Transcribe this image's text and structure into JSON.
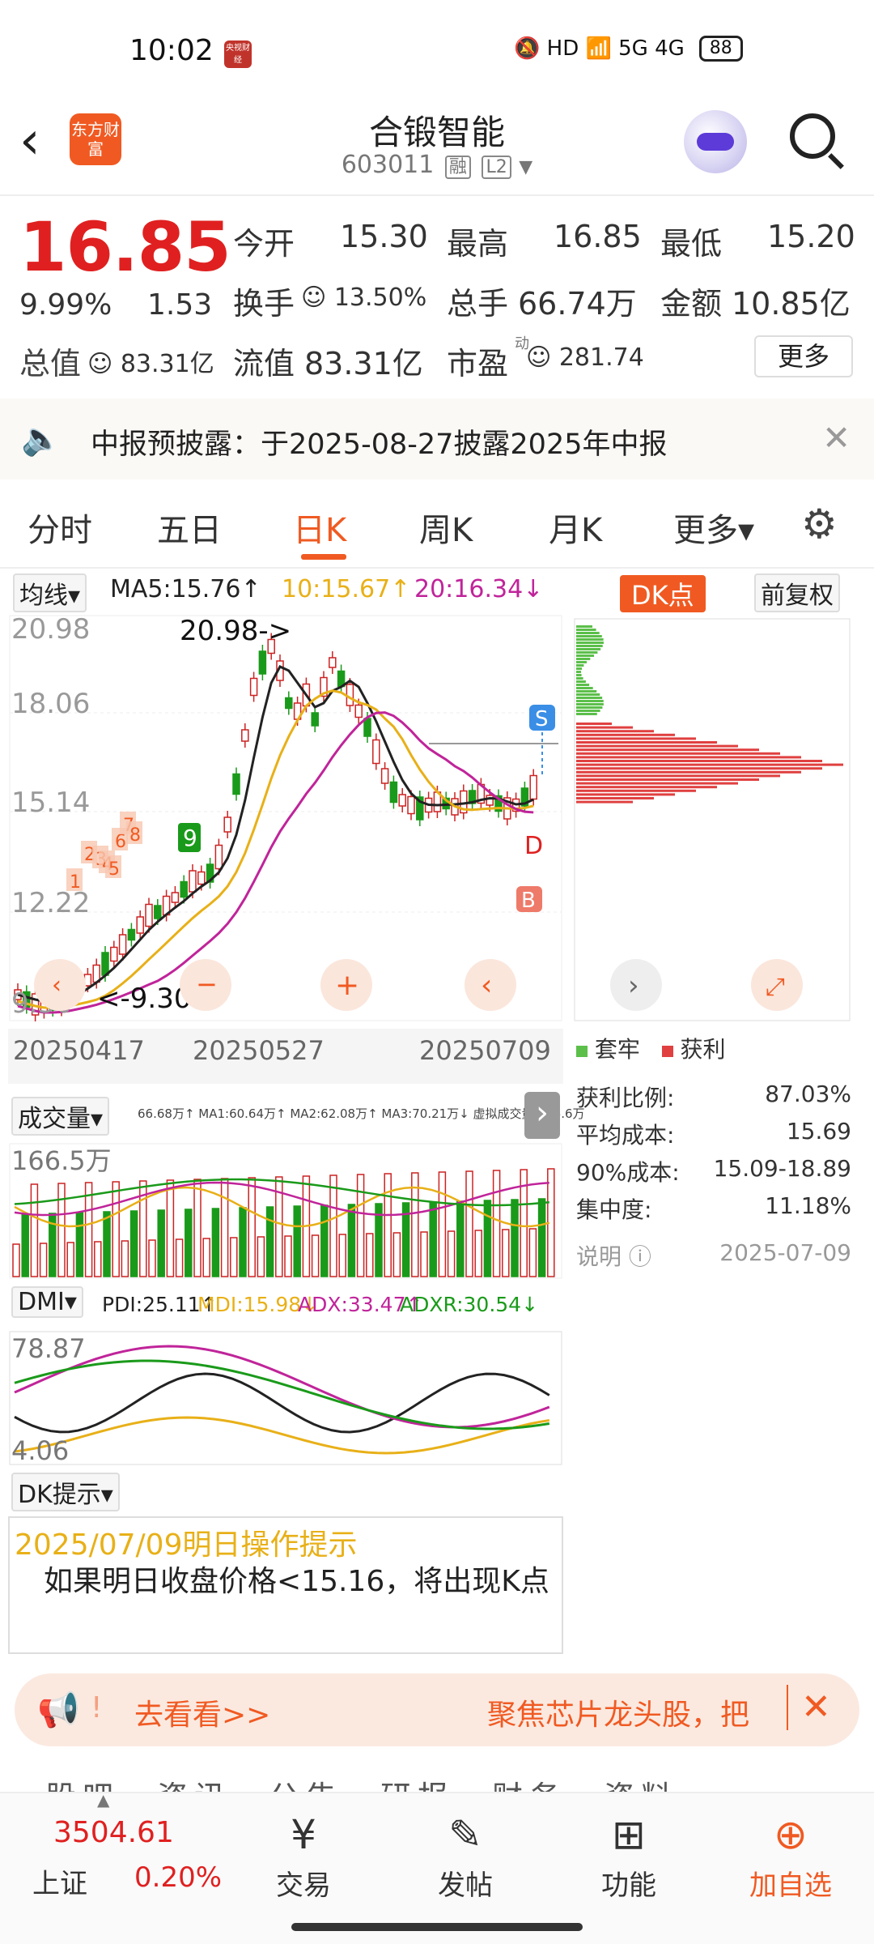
{
  "status_bar": {
    "time": "10:02",
    "news_badge": "央视财经",
    "icons": "🔕 HD 📶 5G 4G",
    "battery": "88"
  },
  "header": {
    "app_logo": "东方财富",
    "title": "合锻智能",
    "code": "603011",
    "tag_rong": "融",
    "tag_l2": "L2"
  },
  "quote": {
    "price": "16.85",
    "change_pct": "9.99%",
    "change": "1.53",
    "open_label": "今开",
    "open": "15.30",
    "high_label": "最高",
    "high": "16.85",
    "low_label": "最低",
    "low": "15.20",
    "turnover_label": "换手",
    "turnover": "13.50%",
    "volume_label": "总手",
    "volume": "66.74万",
    "amount_label": "金额",
    "amount": "10.85亿",
    "mktcap_label": "总值",
    "mktcap": "83.31亿",
    "float_label": "流值",
    "float": "83.31亿",
    "pe_label": "市盈",
    "pe_sup": "动",
    "pe": "281.74",
    "more_label": "更多"
  },
  "notice": {
    "text": "中报预披露：于2025-08-27披露2025年中报"
  },
  "tabs": [
    "分时",
    "五日",
    "日K",
    "周K",
    "月K",
    "更多▾"
  ],
  "active_tab": "日K",
  "ma_bar": {
    "selector": "均线▾",
    "ma5": "MA5:15.76↑",
    "ma10": "10:15.67↑",
    "ma20": "20:16.34↓",
    "dk_button": "DK点",
    "adjust": "前复权"
  },
  "kline": {
    "y_labels": [
      "20.98",
      "18.06",
      "15.14",
      "12.22",
      "9.30"
    ],
    "x_labels": [
      "20250417",
      "20250527",
      "20250709"
    ],
    "max_annotation": "20.98->",
    "min_annotation": "<-9.30",
    "markers": {
      "s": "S",
      "d": "D",
      "b": "B",
      "nine": "9",
      "seq": [
        "1",
        "2",
        "3",
        "4",
        "5",
        "6",
        "7",
        "8"
      ]
    }
  },
  "chip_panel": {
    "legend_trapped": "套牢",
    "legend_profit": "获利",
    "rows": [
      {
        "label": "获利比例:",
        "value": "87.03%"
      },
      {
        "label": "平均成本:",
        "value": "15.69"
      },
      {
        "label": "90%成本:",
        "value": "15.09-18.89"
      },
      {
        "label": "集中度:",
        "value": "11.18%"
      }
    ],
    "note_label": "说明",
    "date": "2025-07-09"
  },
  "volume": {
    "selector": "成交量▾",
    "info": "66.68万↑ MA1:60.64万↑ MA2:62.08万↑ MA3:70.21万↓ 虚拟成交量:106.6万",
    "y_label": "166.5万"
  },
  "dmi": {
    "selector": "DMI▾",
    "pdi": "PDI:25.11↑",
    "mdi": "MDI:15.98↓",
    "adx": "ADX:33.47↑",
    "adxr": "ADXR:30.54↓",
    "y_top": "78.87",
    "y_bottom": "4.06"
  },
  "dk_tip": {
    "selector": "DK提示▾",
    "title": "2025/07/09明日操作提示",
    "body": "　如果明日收盘价格<15.16，将出现K点"
  },
  "promo": {
    "left": "去看看>>",
    "right": "聚焦芯片龙头股，把"
  },
  "subtabs": "股吧　资讯　公告　研报　财务　资料",
  "bottom_nav": {
    "index_value": "3504.61",
    "index_name": "上证",
    "index_change": "0.20%",
    "items": [
      "交易",
      "发帖",
      "功能",
      "加自选"
    ]
  },
  "colors": {
    "up": "#e02020",
    "down": "#1a9a1a",
    "accent": "#f05a22",
    "ma10": "#e8b018",
    "ma20": "#c0249a"
  }
}
